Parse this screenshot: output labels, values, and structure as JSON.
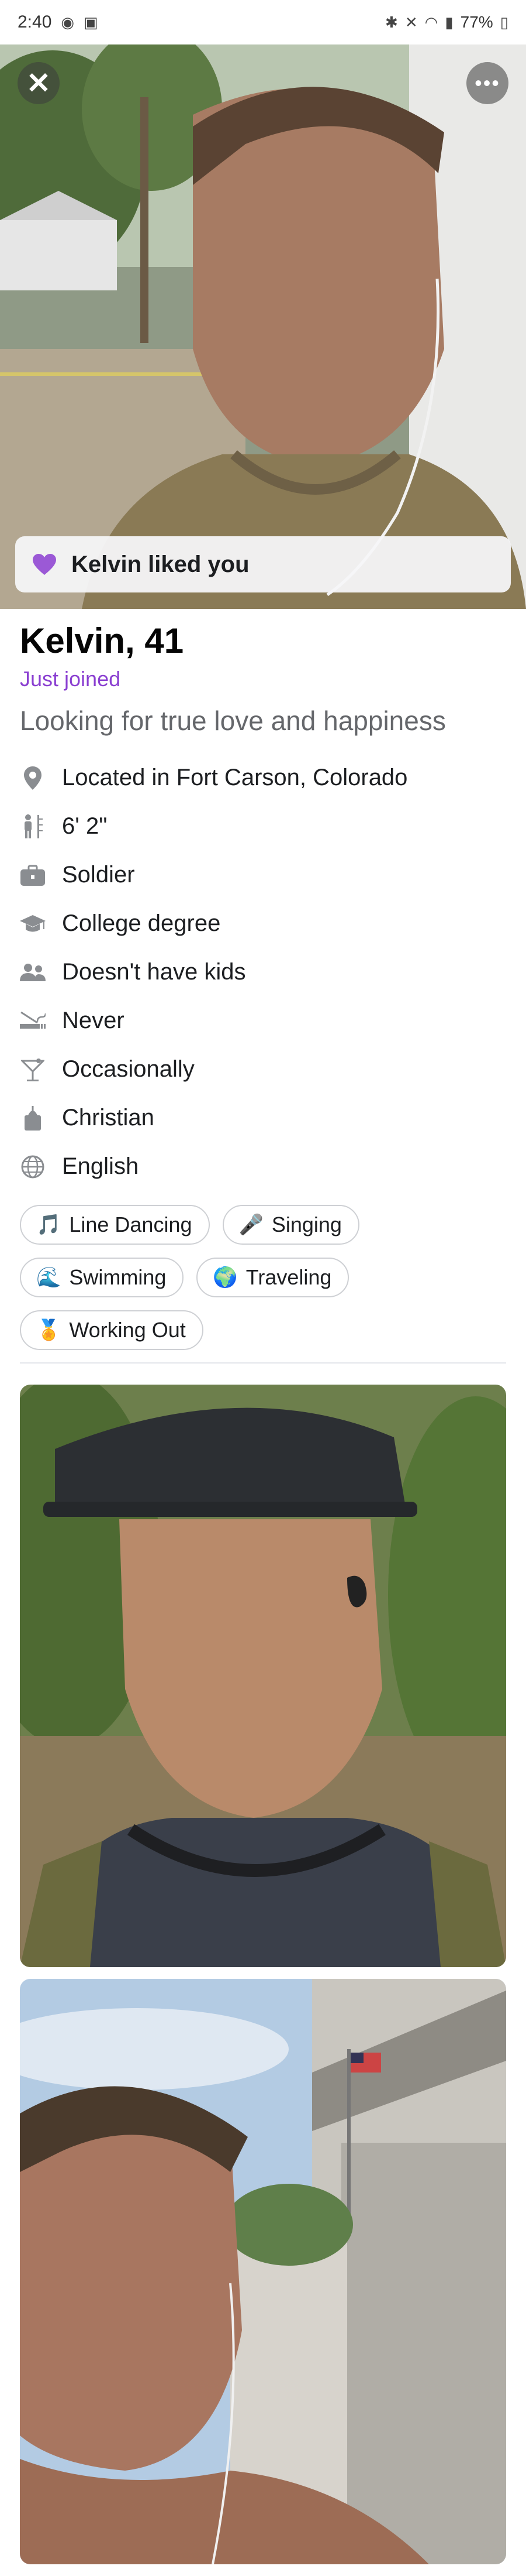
{
  "status_bar": {
    "time": "2:40",
    "battery": "77%"
  },
  "hero": {
    "close_icon": "close-icon",
    "more_icon": "more-options-icon",
    "liked_text": "Kelvin liked you"
  },
  "profile": {
    "name_age": "Kelvin, 41",
    "joined": "Just joined",
    "tagline": "Looking for true love and happiness",
    "details": [
      {
        "icon": "location-pin-icon",
        "text": "Located in Fort Carson, Colorado"
      },
      {
        "icon": "height-icon",
        "text": "6' 2\""
      },
      {
        "icon": "briefcase-icon",
        "text": "Soldier"
      },
      {
        "icon": "graduation-cap-icon",
        "text": "College degree"
      },
      {
        "icon": "people-icon",
        "text": "Doesn't have kids"
      },
      {
        "icon": "smoking-icon",
        "text": "Never"
      },
      {
        "icon": "cocktail-icon",
        "text": "Occasionally"
      },
      {
        "icon": "religion-icon",
        "text": "Christian"
      },
      {
        "icon": "globe-icon",
        "text": "English"
      }
    ],
    "interests": [
      {
        "icon": "🎵",
        "label": "Line Dancing"
      },
      {
        "icon": "🎤",
        "label": "Singing"
      },
      {
        "icon": "🌊",
        "label": "Swimming"
      },
      {
        "icon": "🌍",
        "label": "Traveling"
      },
      {
        "icon": "🏅",
        "label": "Working Out"
      }
    ]
  },
  "colors": {
    "accent_purple": "#8a3fd1",
    "secondary_text": "#65676b",
    "divider": "#e4e6eb"
  }
}
